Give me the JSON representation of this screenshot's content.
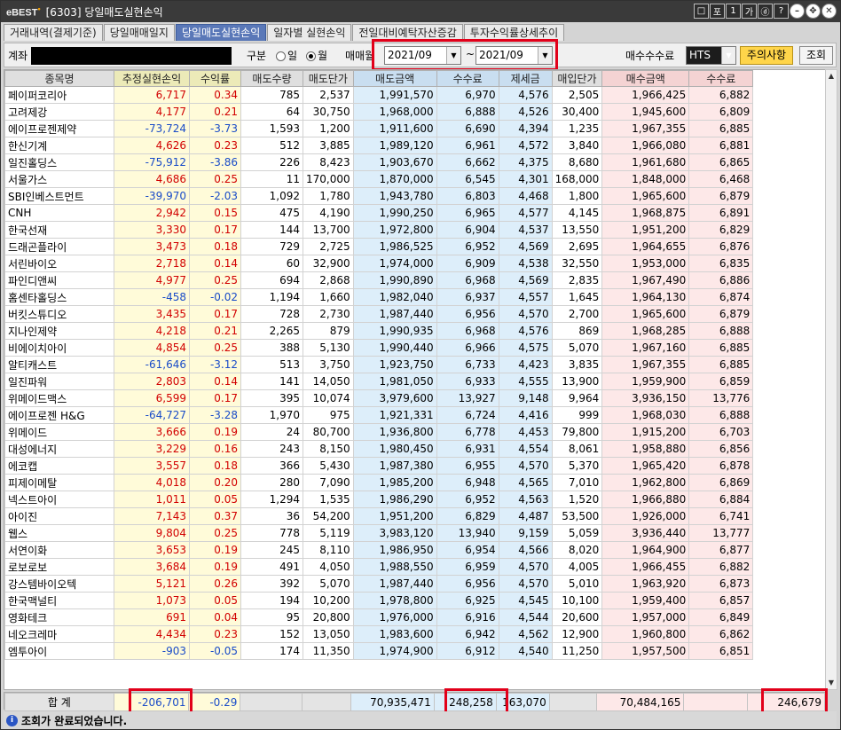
{
  "window": {
    "logo": "eBEST",
    "title": "[6303] 당일매도실현손익"
  },
  "window_buttons": [
    "□",
    "포",
    "1",
    "가",
    "ⓓ",
    "?"
  ],
  "tabs": [
    {
      "label": "거래내역(결제기준)",
      "active": false
    },
    {
      "label": "당일매매일지",
      "active": false
    },
    {
      "label": "당일매도실현손익",
      "active": true
    },
    {
      "label": "일자별 실현손익",
      "active": false
    },
    {
      "label": "전일대비예탁자산증감",
      "active": false
    },
    {
      "label": "투자수익률상세추이",
      "active": false
    }
  ],
  "controls": {
    "account_label": "계좌",
    "type_label": "구분",
    "radio_day": "일",
    "radio_month": "월",
    "period_label": "매매월",
    "from": "2021/09",
    "tilde": "~",
    "to": "2021/09",
    "fee_label": "매수수수료",
    "fee_value": "HTS",
    "notice_button": "주의사항",
    "query_button": "조회"
  },
  "columns": [
    "종목명",
    "추정실현손익",
    "수익률",
    "매도수량",
    "매도단가",
    "매도금액",
    "수수료",
    "제세금",
    "매입단가",
    "매수금액",
    "수수료"
  ],
  "rows": [
    [
      "페이퍼코리아",
      "6,717",
      "0.34",
      "785",
      "2,537",
      "1,991,570",
      "6,970",
      "4,576",
      "2,505",
      "1,966,425",
      "6,882"
    ],
    [
      "고려제강",
      "4,177",
      "0.21",
      "64",
      "30,750",
      "1,968,000",
      "6,888",
      "4,526",
      "30,400",
      "1,945,600",
      "6,809"
    ],
    [
      "에이프로젠제약",
      "-73,724",
      "-3.73",
      "1,593",
      "1,200",
      "1,911,600",
      "6,690",
      "4,394",
      "1,235",
      "1,967,355",
      "6,885"
    ],
    [
      "한신기계",
      "4,626",
      "0.23",
      "512",
      "3,885",
      "1,989,120",
      "6,961",
      "4,572",
      "3,840",
      "1,966,080",
      "6,881"
    ],
    [
      "일진홀딩스",
      "-75,912",
      "-3.86",
      "226",
      "8,423",
      "1,903,670",
      "6,662",
      "4,375",
      "8,680",
      "1,961,680",
      "6,865"
    ],
    [
      "서울가스",
      "4,686",
      "0.25",
      "11",
      "170,000",
      "1,870,000",
      "6,545",
      "4,301",
      "168,000",
      "1,848,000",
      "6,468"
    ],
    [
      "SBI인베스트먼트",
      "-39,970",
      "-2.03",
      "1,092",
      "1,780",
      "1,943,780",
      "6,803",
      "4,468",
      "1,800",
      "1,965,600",
      "6,879"
    ],
    [
      "CNH",
      "2,942",
      "0.15",
      "475",
      "4,190",
      "1,990,250",
      "6,965",
      "4,577",
      "4,145",
      "1,968,875",
      "6,891"
    ],
    [
      "한국선재",
      "3,330",
      "0.17",
      "144",
      "13,700",
      "1,972,800",
      "6,904",
      "4,537",
      "13,550",
      "1,951,200",
      "6,829"
    ],
    [
      "드래곤플라이",
      "3,473",
      "0.18",
      "729",
      "2,725",
      "1,986,525",
      "6,952",
      "4,569",
      "2,695",
      "1,964,655",
      "6,876"
    ],
    [
      "서린바이오",
      "2,718",
      "0.14",
      "60",
      "32,900",
      "1,974,000",
      "6,909",
      "4,538",
      "32,550",
      "1,953,000",
      "6,835"
    ],
    [
      "파인디앤씨",
      "4,977",
      "0.25",
      "694",
      "2,868",
      "1,990,890",
      "6,968",
      "4,569",
      "2,835",
      "1,967,490",
      "6,886"
    ],
    [
      "홈센타홀딩스",
      "-458",
      "-0.02",
      "1,194",
      "1,660",
      "1,982,040",
      "6,937",
      "4,557",
      "1,645",
      "1,964,130",
      "6,874"
    ],
    [
      "버킷스튜디오",
      "3,435",
      "0.17",
      "728",
      "2,730",
      "1,987,440",
      "6,956",
      "4,570",
      "2,700",
      "1,965,600",
      "6,879"
    ],
    [
      "지나인제약",
      "4,218",
      "0.21",
      "2,265",
      "879",
      "1,990,935",
      "6,968",
      "4,576",
      "869",
      "1,968,285",
      "6,888"
    ],
    [
      "비에이치아이",
      "4,854",
      "0.25",
      "388",
      "5,130",
      "1,990,440",
      "6,966",
      "4,575",
      "5,070",
      "1,967,160",
      "6,885"
    ],
    [
      "알티캐스트",
      "-61,646",
      "-3.12",
      "513",
      "3,750",
      "1,923,750",
      "6,733",
      "4,423",
      "3,835",
      "1,967,355",
      "6,885"
    ],
    [
      "일진파워",
      "2,803",
      "0.14",
      "141",
      "14,050",
      "1,981,050",
      "6,933",
      "4,555",
      "13,900",
      "1,959,900",
      "6,859"
    ],
    [
      "위메이드맥스",
      "6,599",
      "0.17",
      "395",
      "10,074",
      "3,979,600",
      "13,927",
      "9,148",
      "9,964",
      "3,936,150",
      "13,776"
    ],
    [
      "에이프로젠 H&G",
      "-64,727",
      "-3.28",
      "1,970",
      "975",
      "1,921,331",
      "6,724",
      "4,416",
      "999",
      "1,968,030",
      "6,888"
    ],
    [
      "위메이드",
      "3,666",
      "0.19",
      "24",
      "80,700",
      "1,936,800",
      "6,778",
      "4,453",
      "79,800",
      "1,915,200",
      "6,703"
    ],
    [
      "대성에너지",
      "3,229",
      "0.16",
      "243",
      "8,150",
      "1,980,450",
      "6,931",
      "4,554",
      "8,061",
      "1,958,880",
      "6,856"
    ],
    [
      "에코캡",
      "3,557",
      "0.18",
      "366",
      "5,430",
      "1,987,380",
      "6,955",
      "4,570",
      "5,370",
      "1,965,420",
      "6,878"
    ],
    [
      "피제이메탈",
      "4,018",
      "0.20",
      "280",
      "7,090",
      "1,985,200",
      "6,948",
      "4,565",
      "7,010",
      "1,962,800",
      "6,869"
    ],
    [
      "넥스트아이",
      "1,011",
      "0.05",
      "1,294",
      "1,535",
      "1,986,290",
      "6,952",
      "4,563",
      "1,520",
      "1,966,880",
      "6,884"
    ],
    [
      "아이진",
      "7,143",
      "0.37",
      "36",
      "54,200",
      "1,951,200",
      "6,829",
      "4,487",
      "53,500",
      "1,926,000",
      "6,741"
    ],
    [
      "웹스",
      "9,804",
      "0.25",
      "778",
      "5,119",
      "3,983,120",
      "13,940",
      "9,159",
      "5,059",
      "3,936,440",
      "13,777"
    ],
    [
      "서연이화",
      "3,653",
      "0.19",
      "245",
      "8,110",
      "1,986,950",
      "6,954",
      "4,566",
      "8,020",
      "1,964,900",
      "6,877"
    ],
    [
      "로보로보",
      "3,684",
      "0.19",
      "491",
      "4,050",
      "1,988,550",
      "6,959",
      "4,570",
      "4,005",
      "1,966,455",
      "6,882"
    ],
    [
      "강스템바이오텍",
      "5,121",
      "0.26",
      "392",
      "5,070",
      "1,987,440",
      "6,956",
      "4,570",
      "5,010",
      "1,963,920",
      "6,873"
    ],
    [
      "한국맥널티",
      "1,073",
      "0.05",
      "194",
      "10,200",
      "1,978,800",
      "6,925",
      "4,545",
      "10,100",
      "1,959,400",
      "6,857"
    ],
    [
      "영화테크",
      "691",
      "0.04",
      "95",
      "20,800",
      "1,976,000",
      "6,916",
      "4,544",
      "20,600",
      "1,957,000",
      "6,849"
    ],
    [
      "네오크레마",
      "4,434",
      "0.23",
      "152",
      "13,050",
      "1,983,600",
      "6,942",
      "4,562",
      "12,900",
      "1,960,800",
      "6,862"
    ],
    [
      "엠투아이",
      "-903",
      "-0.05",
      "174",
      "11,350",
      "1,974,900",
      "6,912",
      "4,540",
      "11,250",
      "1,957,500",
      "6,851"
    ]
  ],
  "totals": {
    "label": "합 계",
    "pnl": "-206,701",
    "rate": "-0.29",
    "sell_amount": "70,935,471",
    "sell_fee": "248,258",
    "tax": "163,070",
    "buy_amount": "70,484,165",
    "buy_fee": "246,679"
  },
  "status": {
    "icon": "i",
    "message": "조회가 완료되었습니다."
  },
  "colors": {
    "positive": "#d20000",
    "negative": "#1a4cc8",
    "active_tab": "#5a78b8",
    "highlight": "#e2001a",
    "sell_bg": "#ddeefa",
    "buy_bg": "#fde8e8",
    "pnl_bg": "#fffbd9"
  }
}
